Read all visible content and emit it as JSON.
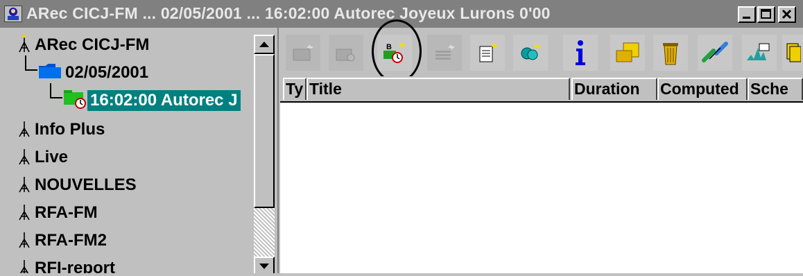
{
  "window": {
    "title": "ARec CICJ-FM ... 02/05/2001 ... 16:02:00 Autorec Joyeux Lurons 0'00",
    "icon": "radio-station-icon",
    "controls": {
      "minimize_icon": "minimize-icon",
      "maximize_icon": "maximize-icon",
      "close_icon": "close-icon"
    }
  },
  "tree": {
    "items": [
      {
        "label": "ARec CICJ-FM",
        "icon": "antenna-icon",
        "level": 0
      },
      {
        "label": "02/05/2001",
        "icon": "blue-folder-icon",
        "level": 1
      },
      {
        "label": "16:02:00 Autorec J",
        "icon": "green-folder-clock-icon",
        "level": 2,
        "selected": true
      },
      {
        "label": "Info Plus",
        "icon": "antenna-icon",
        "level": 0
      },
      {
        "label": "Live",
        "icon": "antenna-icon",
        "level": 0
      },
      {
        "label": "NOUVELLES",
        "icon": "antenna-icon",
        "level": 0
      },
      {
        "label": "RFA-FM",
        "icon": "antenna-icon",
        "level": 0
      },
      {
        "label": "RFA-FM2",
        "icon": "antenna-icon",
        "level": 0
      },
      {
        "label": "RFI-report",
        "icon": "antenna-icon",
        "level": 0
      }
    ],
    "selected_color": "#008080"
  },
  "toolbar": {
    "buttons": [
      {
        "name": "new-folder-button",
        "icon": "new-folder-icon",
        "enabled": false
      },
      {
        "name": "new-scheduled-folder-button",
        "icon": "new-scheduled-folder-icon",
        "enabled": false
      },
      {
        "name": "new-block-button",
        "icon": "new-block-clock-icon",
        "enabled": true,
        "circled": true
      },
      {
        "name": "new-item-button",
        "icon": "new-item-icon",
        "enabled": false
      },
      {
        "name": "new-note-button",
        "icon": "note-icon",
        "enabled": true
      },
      {
        "name": "new-group-button",
        "icon": "group-icon",
        "enabled": true
      },
      {
        "name": "info-button",
        "icon": "info-icon",
        "enabled": true
      },
      {
        "name": "move-button",
        "icon": "move-folder-icon",
        "enabled": true
      },
      {
        "name": "delete-button",
        "icon": "trash-icon",
        "enabled": true
      },
      {
        "name": "link-button",
        "icon": "link-icon",
        "enabled": true
      },
      {
        "name": "waveform-button",
        "icon": "waveform-icon",
        "enabled": true
      },
      {
        "name": "copy-button",
        "icon": "copy-icon",
        "enabled": true
      }
    ]
  },
  "grid": {
    "columns": [
      "Ty",
      "Title",
      "Duration",
      "Computed",
      "Sche"
    ],
    "rows": []
  }
}
